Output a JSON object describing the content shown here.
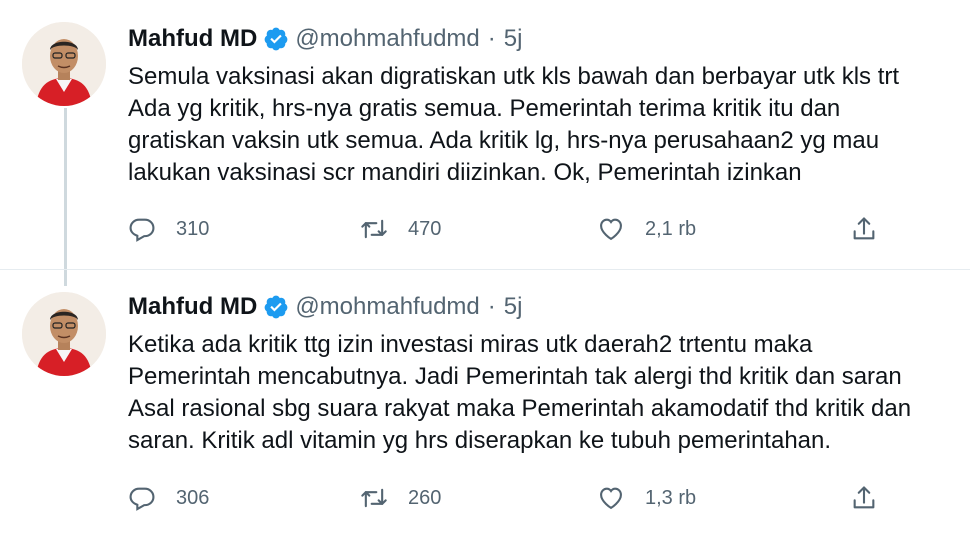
{
  "tweets": [
    {
      "author": {
        "name": "Mahfud MD",
        "handle": "@mohmahfudmd",
        "time": "5j"
      },
      "lines": [
        "Semula vaksinasi akan digratiskan utk kls bawah dan berbayar utk kls trt",
        "Ada yg kritik, hrs-nya gratis semua. Pemerintah terima kritik itu dan",
        "gratiskan vaksin utk semua. Ada kritik lg, hrs-nya perusahaan2 yg mau",
        "lakukan vaksinasi scr mandiri diizinkan. Ok, Pemerintah izinkan"
      ],
      "replies": "310",
      "retweets": "470",
      "likes": "2,1 rb"
    },
    {
      "author": {
        "name": "Mahfud MD",
        "handle": "@mohmahfudmd",
        "time": "5j"
      },
      "lines": [
        "Ketika ada kritik ttg izin investasi miras utk daerah2 trtentu maka",
        "Pemerintah mencabutnya. Jadi Pemerintah tak alergi thd kritik dan saran",
        "Asal rasional sbg suara rakyat maka Pemerintah akamodatif thd kritik dan",
        "saran. Kritik adl vitamin yg hrs diserapkan ke tubuh pemerintahan."
      ],
      "replies": "306",
      "retweets": "260",
      "likes": "1,3 rb"
    }
  ],
  "icons": {
    "verified": "verified-badge-icon",
    "reply": "reply-icon",
    "retweet": "retweet-icon",
    "like": "heart-icon",
    "share": "share-icon"
  },
  "colors": {
    "verified": "#1d9bf0",
    "text": "#0f1419",
    "secondary": "#536471",
    "thread_line": "#cfd9de"
  }
}
